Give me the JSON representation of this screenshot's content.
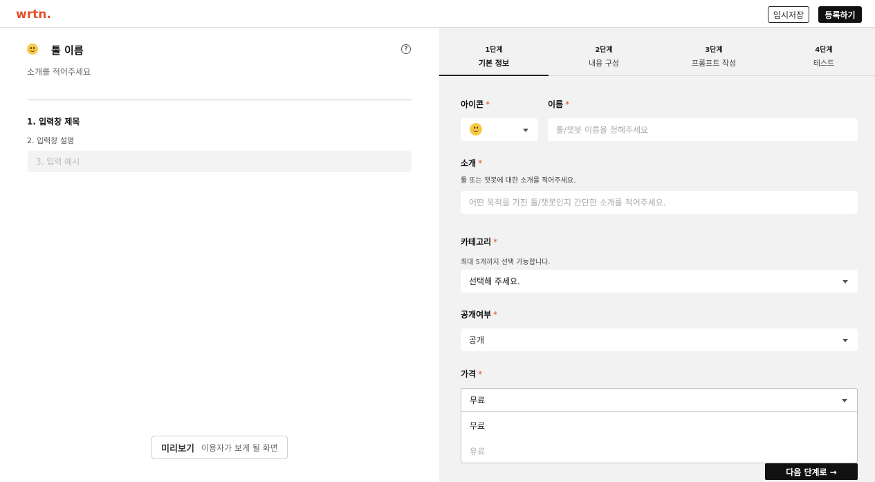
{
  "header": {
    "logo": "wrtn.",
    "save_label": "임시저장",
    "register_label": "등록하기"
  },
  "preview": {
    "tool_name": "툴 이름",
    "intro_placeholder": "소개를 적어주세요",
    "items": [
      "1. 입력창 제목",
      "2. 입력창 설명",
      "3. 입력 예시"
    ],
    "preview_button_label": "미리보기",
    "preview_button_desc": "이용자가 보게 될 화면"
  },
  "steps": [
    {
      "num": "1단계",
      "label": "기본 정보",
      "active": true
    },
    {
      "num": "2단계",
      "label": "내용 구성",
      "active": false
    },
    {
      "num": "3단계",
      "label": "프롬프트 작성",
      "active": false
    },
    {
      "num": "4단계",
      "label": "테스트",
      "active": false
    }
  ],
  "form": {
    "icon_label": "아이콘",
    "name_label": "이름",
    "name_placeholder": "툴/챗봇 이름을 정해주세요",
    "intro_label": "소개",
    "intro_hint": "툴 또는 챗봇에 대한 소개를 적어주세요.",
    "intro_placeholder": "어떤 목적을 가진 툴/챗봇인지 간단한 소개를 적어주세요.",
    "category_label": "카테고리",
    "category_hint": "최대 5개까지 선택 가능합니다.",
    "category_value": "선택해 주세요.",
    "visibility_label": "공개여부",
    "visibility_value": "공개",
    "price_label": "가격",
    "price_value": "무료",
    "price_options": [
      "무료",
      "유료"
    ],
    "required_mark": "*",
    "next_label": "다음 단계로 →"
  },
  "colors": {
    "accent": "#e5502b",
    "dark": "#111111",
    "panel_bg": "#f2f2f2"
  }
}
